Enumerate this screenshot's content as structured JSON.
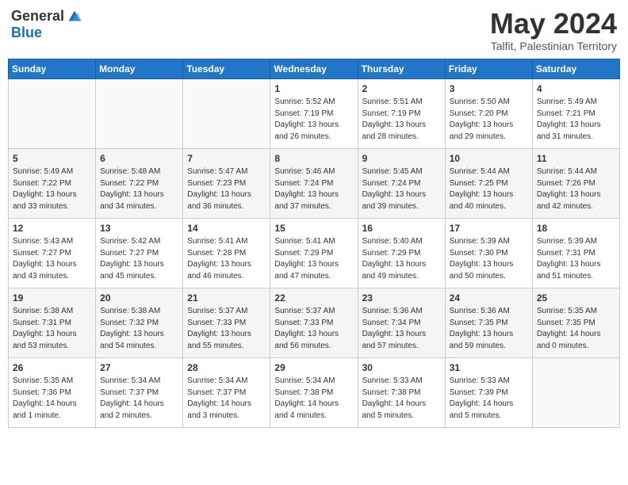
{
  "header": {
    "logo_general": "General",
    "logo_blue": "Blue",
    "month": "May 2024",
    "location": "Talfit, Palestinian Territory"
  },
  "days_of_week": [
    "Sunday",
    "Monday",
    "Tuesday",
    "Wednesday",
    "Thursday",
    "Friday",
    "Saturday"
  ],
  "weeks": [
    [
      {
        "day": "",
        "info": ""
      },
      {
        "day": "",
        "info": ""
      },
      {
        "day": "",
        "info": ""
      },
      {
        "day": "1",
        "info": "Sunrise: 5:52 AM\nSunset: 7:19 PM\nDaylight: 13 hours\nand 26 minutes."
      },
      {
        "day": "2",
        "info": "Sunrise: 5:51 AM\nSunset: 7:19 PM\nDaylight: 13 hours\nand 28 minutes."
      },
      {
        "day": "3",
        "info": "Sunrise: 5:50 AM\nSunset: 7:20 PM\nDaylight: 13 hours\nand 29 minutes."
      },
      {
        "day": "4",
        "info": "Sunrise: 5:49 AM\nSunset: 7:21 PM\nDaylight: 13 hours\nand 31 minutes."
      }
    ],
    [
      {
        "day": "5",
        "info": "Sunrise: 5:49 AM\nSunset: 7:22 PM\nDaylight: 13 hours\nand 33 minutes."
      },
      {
        "day": "6",
        "info": "Sunrise: 5:48 AM\nSunset: 7:22 PM\nDaylight: 13 hours\nand 34 minutes."
      },
      {
        "day": "7",
        "info": "Sunrise: 5:47 AM\nSunset: 7:23 PM\nDaylight: 13 hours\nand 36 minutes."
      },
      {
        "day": "8",
        "info": "Sunrise: 5:46 AM\nSunset: 7:24 PM\nDaylight: 13 hours\nand 37 minutes."
      },
      {
        "day": "9",
        "info": "Sunrise: 5:45 AM\nSunset: 7:24 PM\nDaylight: 13 hours\nand 39 minutes."
      },
      {
        "day": "10",
        "info": "Sunrise: 5:44 AM\nSunset: 7:25 PM\nDaylight: 13 hours\nand 40 minutes."
      },
      {
        "day": "11",
        "info": "Sunrise: 5:44 AM\nSunset: 7:26 PM\nDaylight: 13 hours\nand 42 minutes."
      }
    ],
    [
      {
        "day": "12",
        "info": "Sunrise: 5:43 AM\nSunset: 7:27 PM\nDaylight: 13 hours\nand 43 minutes."
      },
      {
        "day": "13",
        "info": "Sunrise: 5:42 AM\nSunset: 7:27 PM\nDaylight: 13 hours\nand 45 minutes."
      },
      {
        "day": "14",
        "info": "Sunrise: 5:41 AM\nSunset: 7:28 PM\nDaylight: 13 hours\nand 46 minutes."
      },
      {
        "day": "15",
        "info": "Sunrise: 5:41 AM\nSunset: 7:29 PM\nDaylight: 13 hours\nand 47 minutes."
      },
      {
        "day": "16",
        "info": "Sunrise: 5:40 AM\nSunset: 7:29 PM\nDaylight: 13 hours\nand 49 minutes."
      },
      {
        "day": "17",
        "info": "Sunrise: 5:39 AM\nSunset: 7:30 PM\nDaylight: 13 hours\nand 50 minutes."
      },
      {
        "day": "18",
        "info": "Sunrise: 5:39 AM\nSunset: 7:31 PM\nDaylight: 13 hours\nand 51 minutes."
      }
    ],
    [
      {
        "day": "19",
        "info": "Sunrise: 5:38 AM\nSunset: 7:31 PM\nDaylight: 13 hours\nand 53 minutes."
      },
      {
        "day": "20",
        "info": "Sunrise: 5:38 AM\nSunset: 7:32 PM\nDaylight: 13 hours\nand 54 minutes."
      },
      {
        "day": "21",
        "info": "Sunrise: 5:37 AM\nSunset: 7:33 PM\nDaylight: 13 hours\nand 55 minutes."
      },
      {
        "day": "22",
        "info": "Sunrise: 5:37 AM\nSunset: 7:33 PM\nDaylight: 13 hours\nand 56 minutes."
      },
      {
        "day": "23",
        "info": "Sunrise: 5:36 AM\nSunset: 7:34 PM\nDaylight: 13 hours\nand 57 minutes."
      },
      {
        "day": "24",
        "info": "Sunrise: 5:36 AM\nSunset: 7:35 PM\nDaylight: 13 hours\nand 59 minutes."
      },
      {
        "day": "25",
        "info": "Sunrise: 5:35 AM\nSunset: 7:35 PM\nDaylight: 14 hours\nand 0 minutes."
      }
    ],
    [
      {
        "day": "26",
        "info": "Sunrise: 5:35 AM\nSunset: 7:36 PM\nDaylight: 14 hours\nand 1 minute."
      },
      {
        "day": "27",
        "info": "Sunrise: 5:34 AM\nSunset: 7:37 PM\nDaylight: 14 hours\nand 2 minutes."
      },
      {
        "day": "28",
        "info": "Sunrise: 5:34 AM\nSunset: 7:37 PM\nDaylight: 14 hours\nand 3 minutes."
      },
      {
        "day": "29",
        "info": "Sunrise: 5:34 AM\nSunset: 7:38 PM\nDaylight: 14 hours\nand 4 minutes."
      },
      {
        "day": "30",
        "info": "Sunrise: 5:33 AM\nSunset: 7:38 PM\nDaylight: 14 hours\nand 5 minutes."
      },
      {
        "day": "31",
        "info": "Sunrise: 5:33 AM\nSunset: 7:39 PM\nDaylight: 14 hours\nand 5 minutes."
      },
      {
        "day": "",
        "info": ""
      }
    ]
  ]
}
